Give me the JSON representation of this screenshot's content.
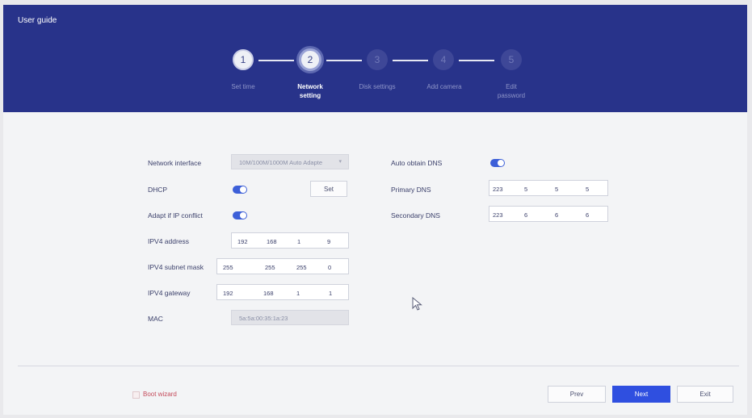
{
  "header": {
    "title": "User guide"
  },
  "steps": [
    {
      "number": "1",
      "label": "Set time",
      "state": "done"
    },
    {
      "number": "2",
      "label": "Network setting",
      "state": "active"
    },
    {
      "number": "3",
      "label": "Disk settings",
      "state": "todo"
    },
    {
      "number": "4",
      "label": "Add camera",
      "state": "todo"
    },
    {
      "number": "5",
      "label": "Edit password",
      "state": "todo"
    }
  ],
  "form": {
    "network_interface": {
      "label": "Network interface",
      "value": "10M/100M/1000M Auto Adapte"
    },
    "dhcp": {
      "label": "DHCP",
      "enabled": true,
      "set_button": "Set"
    },
    "adapt_ip_conflict": {
      "label": "Adapt if IP conflict",
      "enabled": true
    },
    "ipv4_address": {
      "label": "IPV4 address",
      "octets": [
        "192",
        "168",
        "1",
        "9"
      ]
    },
    "ipv4_subnet_mask": {
      "label": "IPV4 subnet mask",
      "octets": [
        "255",
        "255",
        "255",
        "0"
      ]
    },
    "ipv4_gateway": {
      "label": "IPV4 gateway",
      "octets": [
        "192",
        "168",
        "1",
        "1"
      ]
    },
    "mac": {
      "label": "MAC",
      "value": "5a:5a:00:35:1a:23"
    },
    "auto_obtain_dns": {
      "label": "Auto obtain DNS",
      "enabled": true
    },
    "primary_dns": {
      "label": "Primary DNS",
      "octets": [
        "223",
        "5",
        "5",
        "5"
      ]
    },
    "secondary_dns": {
      "label": "Secondary DNS",
      "octets": [
        "223",
        "6",
        "6",
        "6"
      ]
    }
  },
  "footer": {
    "boot_wizard": "Boot wizard",
    "prev": "Prev",
    "next": "Next",
    "exit": "Exit"
  },
  "colors": {
    "header_bg": "#28338a",
    "accent": "#2f4fe0",
    "toggle_on": "#3c5fd8"
  }
}
